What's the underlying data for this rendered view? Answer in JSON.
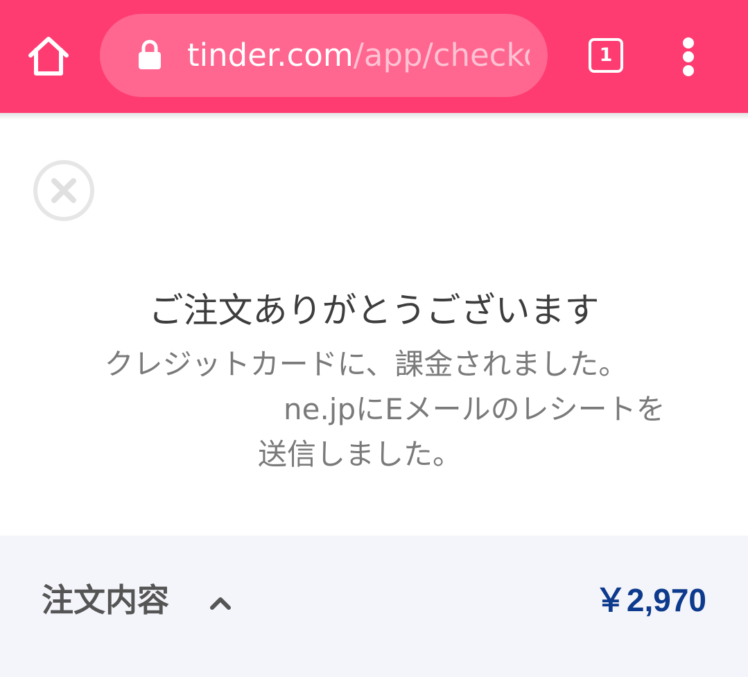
{
  "browser": {
    "url_host": "tinder.com",
    "url_path": "/app/checkout",
    "tab_count": "1",
    "icons": [
      "home-icon",
      "lock-icon",
      "tab-switcher-icon",
      "more-vert-icon"
    ]
  },
  "page": {
    "close_icon": "close-circle-icon",
    "thanks_title": "ご注文ありがとうございます",
    "charged_message": "クレジットカードに、課金されました。",
    "receipt_line1": "ne.jpにEメールのレシートを",
    "receipt_line2": "送信しました。"
  },
  "summary": {
    "label": "注文内容",
    "toggle_icon": "chevron-up-icon",
    "total_price": "￥2,970"
  },
  "colors": {
    "brand_bar": "#fe3c72",
    "url_pill": "#ff6690",
    "price": "#0d3a8c",
    "summary_bg": "#f4f5fa"
  }
}
